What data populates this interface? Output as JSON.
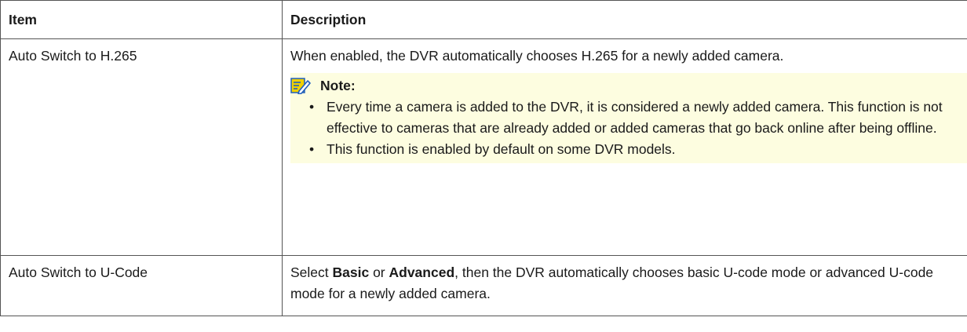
{
  "table": {
    "headers": {
      "item": "Item",
      "description": "Description"
    },
    "rows": [
      {
        "item": "Auto Switch to H.265",
        "description": "When enabled, the DVR automatically chooses H.265 for a newly added camera.",
        "note": {
          "label": "Note:",
          "icon": "note-pencil-icon",
          "bullets": [
            "Every time a camera is added to the DVR, it is considered a newly added camera. This function is not effective to cameras that are already added or added cameras that go back online after being offline.",
            "This function is enabled by default on some DVR models."
          ]
        }
      },
      {
        "item": "Auto Switch to U-Code",
        "description": {
          "pre": "Select ",
          "bold1": "Basic",
          "mid": " or ",
          "bold2": "Advanced",
          "post": ", then the DVR automatically chooses basic U-code mode or advanced U-code mode for a newly added camera."
        }
      }
    ]
  },
  "colors": {
    "note_background": "#fdfde0",
    "note_icon_yellow": "#f0d000",
    "note_icon_blue": "#1f5fbf",
    "border": "#555555"
  }
}
